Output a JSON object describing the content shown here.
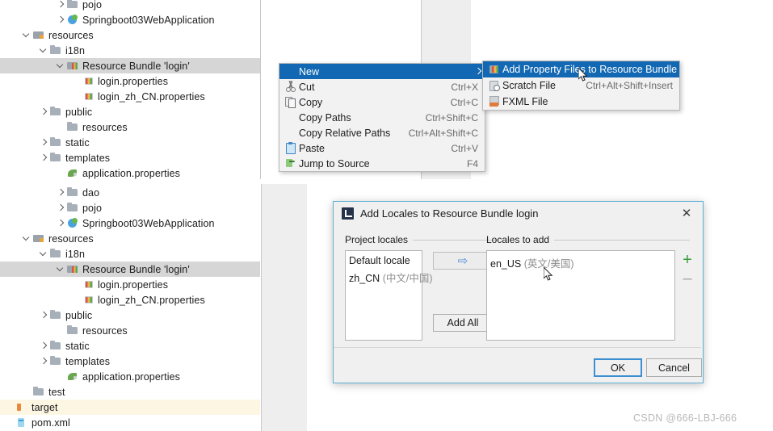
{
  "app": {
    "watermark": "CSDN @666-LBJ-666"
  },
  "tree_top": {
    "items": [
      {
        "label": "pojo",
        "icon": "folder",
        "chevron": "right",
        "indent": 3,
        "state": "normal"
      },
      {
        "label": "Springboot03WebApplication",
        "icon": "spring",
        "chevron": "right",
        "indent": 3,
        "state": "normal"
      },
      {
        "label": "resources",
        "icon": "folder-res",
        "chevron": "down",
        "indent": 1,
        "state": "normal"
      },
      {
        "label": "i18n",
        "icon": "folder",
        "chevron": "down",
        "indent": 2,
        "state": "normal"
      },
      {
        "label": "Resource Bundle 'login'",
        "icon": "bundle",
        "chevron": "down",
        "indent": 3,
        "state": "selected"
      },
      {
        "label": "login.properties",
        "icon": "props",
        "chevron": "none",
        "indent": 4,
        "state": "normal"
      },
      {
        "label": "login_zh_CN.properties",
        "icon": "props",
        "chevron": "none",
        "indent": 4,
        "state": "normal"
      },
      {
        "label": "public",
        "icon": "folder",
        "chevron": "right",
        "indent": 2,
        "state": "normal"
      },
      {
        "label": "resources",
        "icon": "folder",
        "chevron": "none",
        "indent": 3,
        "state": "normal"
      },
      {
        "label": "static",
        "icon": "folder",
        "chevron": "right",
        "indent": 2,
        "state": "normal"
      },
      {
        "label": "templates",
        "icon": "folder",
        "chevron": "right",
        "indent": 2,
        "state": "normal"
      },
      {
        "label": "application.properties",
        "icon": "leaf",
        "chevron": "none",
        "indent": 3,
        "state": "normal"
      }
    ]
  },
  "tree_bottom": {
    "items": [
      {
        "label": "dao",
        "icon": "folder",
        "chevron": "right",
        "indent": 3,
        "state": "normal"
      },
      {
        "label": "pojo",
        "icon": "folder",
        "chevron": "right",
        "indent": 3,
        "state": "normal"
      },
      {
        "label": "Springboot03WebApplication",
        "icon": "spring",
        "chevron": "right",
        "indent": 3,
        "state": "normal"
      },
      {
        "label": "resources",
        "icon": "folder-res",
        "chevron": "down",
        "indent": 1,
        "state": "normal"
      },
      {
        "label": "i18n",
        "icon": "folder",
        "chevron": "down",
        "indent": 2,
        "state": "normal"
      },
      {
        "label": "Resource Bundle 'login'",
        "icon": "bundle",
        "chevron": "down",
        "indent": 3,
        "state": "selected"
      },
      {
        "label": "login.properties",
        "icon": "props",
        "chevron": "none",
        "indent": 4,
        "state": "normal"
      },
      {
        "label": "login_zh_CN.properties",
        "icon": "props",
        "chevron": "none",
        "indent": 4,
        "state": "normal"
      },
      {
        "label": "public",
        "icon": "folder",
        "chevron": "right",
        "indent": 2,
        "state": "normal"
      },
      {
        "label": "resources",
        "icon": "folder",
        "chevron": "none",
        "indent": 3,
        "state": "normal"
      },
      {
        "label": "static",
        "icon": "folder",
        "chevron": "right",
        "indent": 2,
        "state": "normal"
      },
      {
        "label": "templates",
        "icon": "folder",
        "chevron": "right",
        "indent": 2,
        "state": "normal"
      },
      {
        "label": "application.properties",
        "icon": "leaf",
        "chevron": "none",
        "indent": 3,
        "state": "normal"
      },
      {
        "label": "test",
        "icon": "folder",
        "chevron": "none",
        "indent": 1,
        "state": "normal"
      },
      {
        "label": "target",
        "icon": "target",
        "chevron": "none",
        "indent": 0,
        "state": "highlight"
      },
      {
        "label": "pom.xml",
        "icon": "pom",
        "chevron": "none",
        "indent": 0,
        "state": "normal"
      }
    ]
  },
  "context_menu": {
    "items": [
      {
        "label": "New",
        "shortcut": "",
        "icon": "",
        "active": true,
        "submenu": true
      },
      {
        "label": "Cut",
        "shortcut": "Ctrl+X",
        "icon": "cut",
        "active": false,
        "submenu": false
      },
      {
        "label": "Copy",
        "shortcut": "Ctrl+C",
        "icon": "copy",
        "active": false,
        "submenu": false
      },
      {
        "label": "Copy Paths",
        "shortcut": "Ctrl+Shift+C",
        "icon": "",
        "active": false,
        "submenu": false
      },
      {
        "label": "Copy Relative Paths",
        "shortcut": "Ctrl+Alt+Shift+C",
        "icon": "",
        "active": false,
        "submenu": false
      },
      {
        "label": "Paste",
        "shortcut": "Ctrl+V",
        "icon": "paste",
        "active": false,
        "submenu": false
      },
      {
        "label": "Jump to Source",
        "shortcut": "F4",
        "icon": "jump",
        "active": false,
        "submenu": false
      }
    ]
  },
  "submenu": {
    "items": [
      {
        "label": "Add Property Files to Resource Bundle",
        "shortcut": "",
        "icon": "bundleico",
        "active": true
      },
      {
        "label": "Scratch File",
        "shortcut": "Ctrl+Alt+Shift+Insert",
        "icon": "scratch",
        "active": false
      },
      {
        "label": "FXML File",
        "shortcut": "",
        "icon": "fxml",
        "active": false
      }
    ]
  },
  "dialog": {
    "title": "Add Locales to Resource Bundle login",
    "close_label": "✕",
    "project_locales_label": "Project locales",
    "locales_to_add_label": "Locales to add",
    "project_locales": [
      {
        "name": "Default locale",
        "note": ""
      },
      {
        "name": "zh_CN",
        "note": "(中文/中国)"
      }
    ],
    "locales_to_add": [
      {
        "name": "en_US",
        "note": "(英文/美国)"
      }
    ],
    "add_arrow_label": "⇨",
    "add_all_label": "Add All",
    "plus_label": "+",
    "minus_label": "–",
    "ok_label": "OK",
    "cancel_label": "Cancel"
  }
}
